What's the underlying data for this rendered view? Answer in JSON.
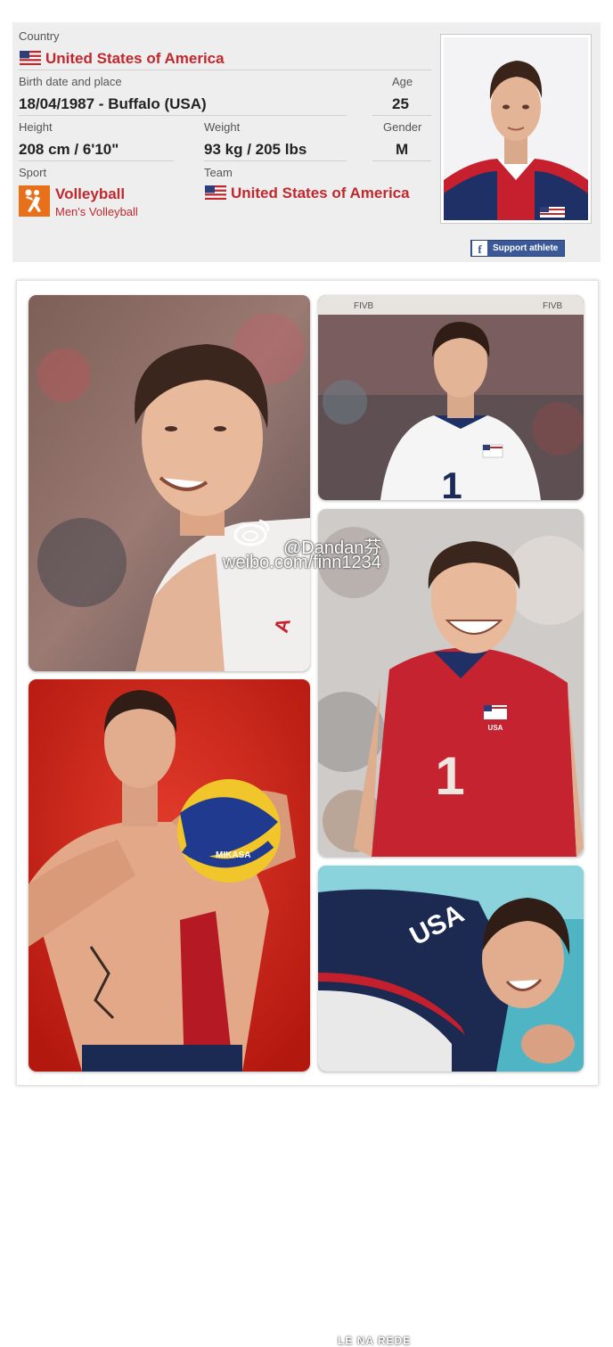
{
  "profile": {
    "country_label": "Country",
    "country_value": "United States of America",
    "birth_label": "Birth date and place",
    "birth_value": "18/04/1987 - Buffalo (USA)",
    "age_label": "Age",
    "age_value": "25",
    "height_label": "Height",
    "height_value": "208 cm / 6'10\"",
    "weight_label": "Weight",
    "weight_value": "93 kg / 205 lbs",
    "gender_label": "Gender",
    "gender_value": "M",
    "sport_label": "Sport",
    "sport_value": "Volleyball",
    "sport_sub": "Men's Volleyball",
    "team_label": "Team",
    "team_value": "United States of America",
    "support_label": "Support athlete",
    "support_icon": "f"
  },
  "colors": {
    "accent_red": "#c0282d",
    "facebook_blue": "#3b5998",
    "sport_orange": "#e8701a"
  },
  "watermark": {
    "handle": "@Dandan芬",
    "site": "weibo.com/finn1234"
  },
  "photos": {
    "banner_text": "FIVB",
    "jersey_number": "1",
    "jersey_text": "USA",
    "ball_brand": "MIKASA",
    "logo_text": "LE  NA REDE"
  }
}
